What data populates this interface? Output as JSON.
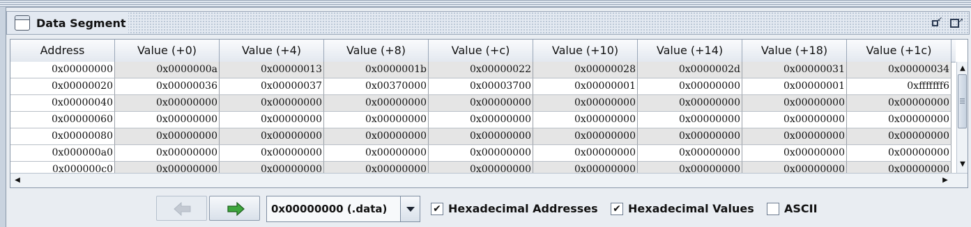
{
  "window": {
    "title": "Data Segment"
  },
  "table": {
    "headers": [
      "Address",
      "Value (+0)",
      "Value (+4)",
      "Value (+8)",
      "Value (+c)",
      "Value (+10)",
      "Value (+14)",
      "Value (+18)",
      "Value (+1c)"
    ],
    "rows": [
      [
        "0x00000000",
        "0x0000000a",
        "0x00000013",
        "0x0000001b",
        "0x00000022",
        "0x00000028",
        "0x0000002d",
        "0x00000031",
        "0x00000034"
      ],
      [
        "0x00000020",
        "0x00000036",
        "0x00000037",
        "0x00370000",
        "0x00003700",
        "0x00000001",
        "0x00000000",
        "0x00000001",
        "0xfffffff6"
      ],
      [
        "0x00000040",
        "0x00000000",
        "0x00000000",
        "0x00000000",
        "0x00000000",
        "0x00000000",
        "0x00000000",
        "0x00000000",
        "0x00000000"
      ],
      [
        "0x00000060",
        "0x00000000",
        "0x00000000",
        "0x00000000",
        "0x00000000",
        "0x00000000",
        "0x00000000",
        "0x00000000",
        "0x00000000"
      ],
      [
        "0x00000080",
        "0x00000000",
        "0x00000000",
        "0x00000000",
        "0x00000000",
        "0x00000000",
        "0x00000000",
        "0x00000000",
        "0x00000000"
      ],
      [
        "0x000000a0",
        "0x00000000",
        "0x00000000",
        "0x00000000",
        "0x00000000",
        "0x00000000",
        "0x00000000",
        "0x00000000",
        "0x00000000"
      ],
      [
        "0x000000c0",
        "0x00000000",
        "0x00000000",
        "0x00000000",
        "0x00000000",
        "0x00000000",
        "0x00000000",
        "0x00000000",
        "0x00000000"
      ]
    ]
  },
  "controls": {
    "segment_selector": "0x00000000 (.data)",
    "hex_addresses_label": "Hexadecimal Addresses",
    "hex_addresses_checked": true,
    "hex_values_label": "Hexadecimal Values",
    "hex_values_checked": true,
    "ascii_label": "ASCII",
    "ascii_checked": false,
    "prev_enabled": false,
    "next_enabled": true
  },
  "colors": {
    "next_arrow": "#3da63d",
    "row_shade": "#e5e5e5",
    "header_border": "#9aa7b8"
  },
  "icons": {
    "window": "window-icon",
    "minimize": "minimize-icon",
    "maximize": "maximize-icon",
    "prev": "arrow-left-icon",
    "next": "arrow-right-icon"
  }
}
